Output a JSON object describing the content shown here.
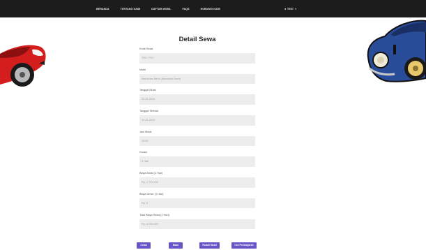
{
  "nav": {
    "links": [
      "BERANDA",
      "TENTANG KAMI",
      "DAFTAR MOBIL",
      "FAQS",
      "HUBUNGI KAMI"
    ],
    "user_icon": "user-icon",
    "user_label": "TEST"
  },
  "page": {
    "title": "Detail Sewa"
  },
  "fields": [
    {
      "label": "Kode Sewa",
      "value": "TRX-7707"
    },
    {
      "label": "Mobil",
      "value": "Mercedes Benz (Mercedes Benz)"
    },
    {
      "label": "Tanggal Mulai",
      "value": "22-01-2024"
    },
    {
      "label": "Tanggal Selesai",
      "value": "24-01-2024"
    },
    {
      "label": "Jam Mulai",
      "value": "10:00"
    },
    {
      "label": "Durasi",
      "value": "2 Hari"
    },
    {
      "label": "Biaya Mobil (1 Hari)",
      "value": "Rp. 1.700.000"
    },
    {
      "label": "Biaya Driver (1 Hari)",
      "value": "Rp. 0"
    },
    {
      "label": "Total Biaya Sewa (2 Hari)",
      "value": "Rp. 3.700.000"
    }
  ],
  "buttons": {
    "cetak": "Cetak",
    "batal": "Batal",
    "ubah": "Rubah Mobil",
    "cek": "Cek Pembayaran"
  },
  "colors": {
    "navbar": "#1c1c1c",
    "button": "#6a55c8",
    "input_bg": "#ededed",
    "car_left": "#d41e1e",
    "car_right": "#2a4d9a"
  }
}
